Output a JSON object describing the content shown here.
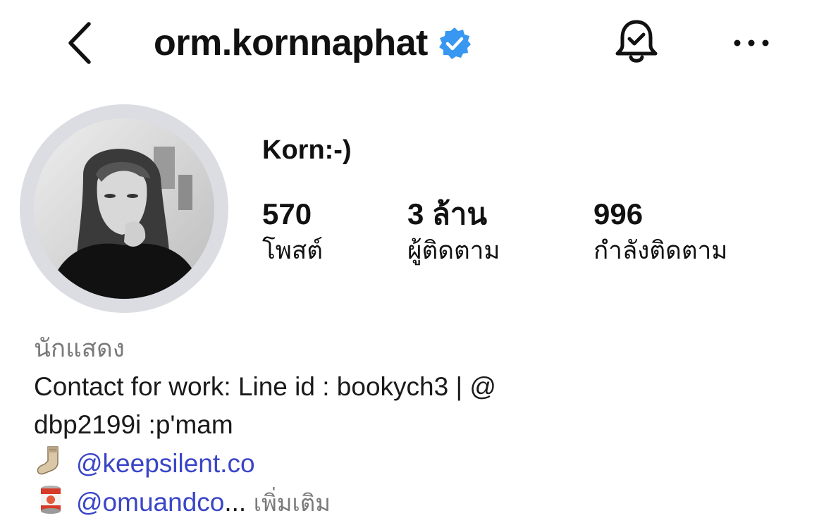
{
  "header": {
    "username": "orm.kornnaphat",
    "icons": {
      "back": "chevron-left-icon",
      "verified": "verified-badge-icon",
      "notifications": "bell-check-icon",
      "more": "more-horizontal-icon"
    }
  },
  "profile": {
    "display_name": "Korn:-)",
    "stats": [
      {
        "value": "570",
        "label": "โพสต์"
      },
      {
        "value": "3 ล้าน",
        "label": "ผู้ติดตาม"
      },
      {
        "value": "996",
        "label": "กำลังติดตาม"
      }
    ]
  },
  "bio": {
    "category": "นักแสดง",
    "line1": "Contact for work: Line id : bookych3 | @",
    "line2": "dbp2199i :p'mam",
    "link1": {
      "icon": "sock-icon",
      "text": "@keepsilent.co"
    },
    "link2": {
      "icon": "can-icon",
      "text": "@omuandco",
      "ellipsis": "...",
      "more": " เพิ่มเติม"
    }
  },
  "colors": {
    "link": "#3a45c8",
    "verified": "#3897f0",
    "muted": "#7a7a7a",
    "avatar_ring": "#dcdde3"
  }
}
